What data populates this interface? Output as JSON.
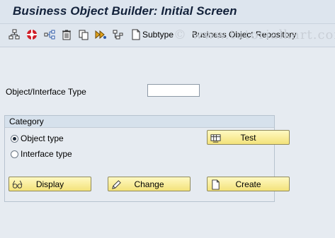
{
  "window": {
    "title": "Business Object Builder: Initial Screen"
  },
  "toolbar": {
    "subtype_label": "Subtype",
    "repository_label": "Business Object Repository",
    "icons": [
      "hierarchy-icon",
      "lifebuoy-icon",
      "connect-icon",
      "trash-icon",
      "copy-icon",
      "execute-icon",
      "tree-icon",
      "document-icon"
    ]
  },
  "watermark": {
    "text": "© www.tutorialkart.com"
  },
  "form": {
    "object_type_label": "Object/Interface Type",
    "object_type_value": ""
  },
  "category": {
    "title": "Category",
    "options": [
      {
        "label": "Object type",
        "selected": true
      },
      {
        "label": "Interface type",
        "selected": false
      }
    ]
  },
  "buttons": {
    "test": "Test",
    "display": "Display",
    "change": "Change",
    "create": "Create"
  },
  "colors": {
    "button_fill": "#f6e88c",
    "title_text": "#13223b",
    "background": "#e6ebf1"
  }
}
